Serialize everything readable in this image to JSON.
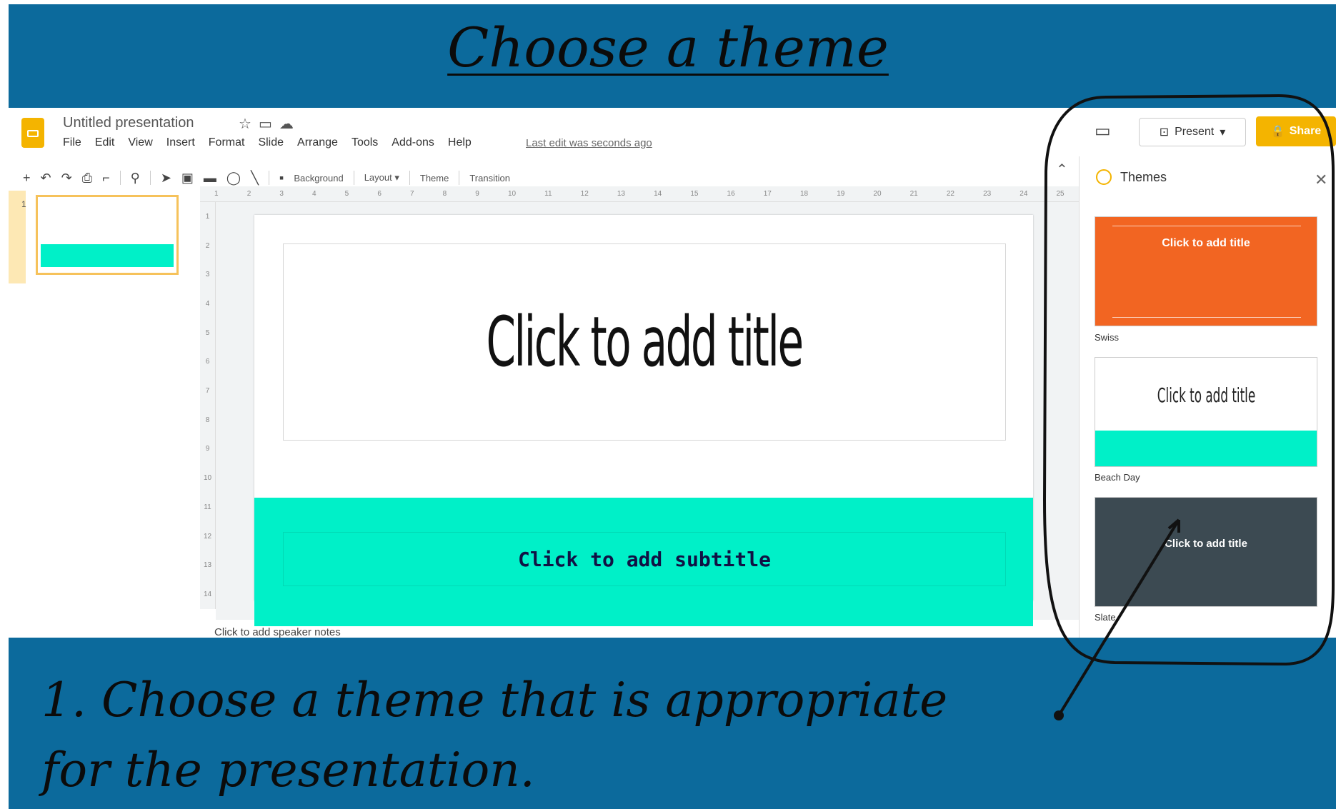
{
  "heading": "Choose a theme",
  "caption": {
    "line1": "1. Choose a theme that is appropriate",
    "line2": "for the presentation."
  },
  "app": {
    "doc_title": "Untitled presentation",
    "menu": [
      "File",
      "Edit",
      "View",
      "Insert",
      "Format",
      "Slide",
      "Arrange",
      "Tools",
      "Add-ons",
      "Help"
    ],
    "last_edit": "Last edit was seconds ago",
    "toolbar": {
      "background": "Background",
      "layout": "Layout ▾",
      "theme": "Theme",
      "transition": "Transition"
    },
    "present_label": "Present",
    "share_label": "Share",
    "slide_number": "1",
    "slide": {
      "title": "Click to add title",
      "subtitle": "Click to add subtitle"
    },
    "speaker_notes": "Click to add speaker notes",
    "ruler_top": [
      "1",
      "2",
      "3",
      "4",
      "5",
      "6",
      "7",
      "8",
      "9",
      "10",
      "11",
      "12",
      "13",
      "14",
      "15",
      "16",
      "17",
      "18",
      "19",
      "20",
      "21",
      "22",
      "23",
      "24",
      "25"
    ],
    "ruler_left": [
      "1",
      "2",
      "3",
      "4",
      "5",
      "6",
      "7",
      "8",
      "9",
      "10",
      "11",
      "12",
      "13",
      "14"
    ]
  },
  "themes_panel": {
    "title": "Themes",
    "themes": [
      {
        "name": "Swiss",
        "preview_title": "Click to add title",
        "color": "#f26522"
      },
      {
        "name": "Beach Day",
        "preview_title": "Click to add title",
        "color": "#00f0c8"
      },
      {
        "name": "Slate",
        "preview_title": "Click to add title",
        "color": "#3c4a52"
      }
    ]
  },
  "colors": {
    "frame_blue": "#0c6a9c",
    "accent_yellow": "#f4b400",
    "slide_band": "#00f0c8"
  }
}
